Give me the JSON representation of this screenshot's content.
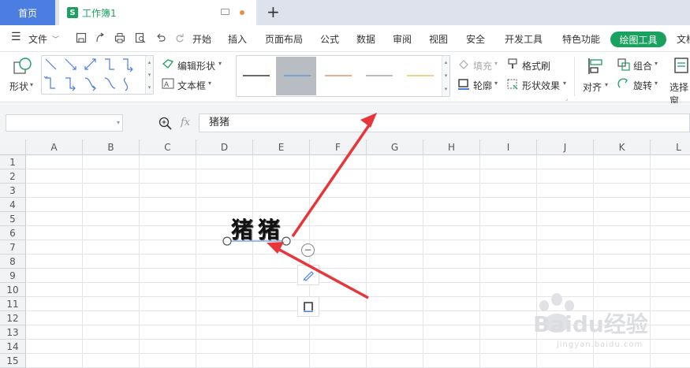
{
  "tabs": {
    "home": "首页",
    "doc_icon": "S",
    "doc_title": "工作簿1",
    "new": "+"
  },
  "menu": {
    "file": "文件",
    "items": [
      "开始",
      "插入",
      "页面布局",
      "公式",
      "数据",
      "审阅",
      "视图",
      "安全",
      "开发工具",
      "特色功能",
      "绘图工具",
      "文档"
    ],
    "active": "绘图工具"
  },
  "ribbon": {
    "shape": "形状",
    "edit_shape": "编辑形状",
    "textbox": "文本框",
    "fill": "填充",
    "format_painter": "格式刷",
    "outline": "轮廓",
    "shape_effect": "形状效果",
    "align": "对齐",
    "group": "组合",
    "rotate": "旋转",
    "select_pane": "选择窗",
    "line_style_colors": [
      "#111111",
      "#5b8fd1",
      "#e07b4c",
      "#999999",
      "#e8b63c"
    ]
  },
  "formula": {
    "fx": "fx",
    "value": "猪猪"
  },
  "columns": [
    "A",
    "B",
    "C",
    "D",
    "E",
    "F",
    "G",
    "H",
    "I",
    "J",
    "K",
    "L"
  ],
  "rows": [
    "1",
    "2",
    "3",
    "4",
    "5",
    "6",
    "7",
    "8",
    "9",
    "10",
    "11",
    "12",
    "13",
    "14",
    "15"
  ],
  "wordart": {
    "text": "猪猪"
  },
  "watermark": {
    "brand": "Baidu经验",
    "url": "jingyan.baidu.com"
  },
  "colors": {
    "accent_green": "#19a15f",
    "home_tab": "#4b7ee0",
    "arrow": "#e8353a"
  }
}
